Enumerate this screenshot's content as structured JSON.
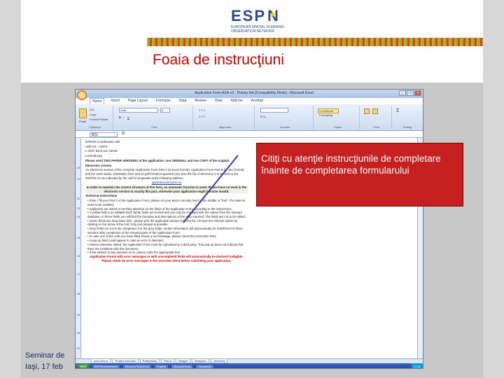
{
  "slide": {
    "title": "Foaia de instrucţiuni",
    "logo": {
      "letters_left": "ESP",
      "letters_right": "N",
      "subtitle": "EUROPEAN SPATIAL PLANNING OBSERVATION NETWORK"
    },
    "footer": {
      "line1": "Seminar de",
      "line2": "Iaşi, 17 feb"
    },
    "callout_text": "Citiţi cu atenţie instrucţiunile de completare înainte de completarea formularului",
    "colors": {
      "title": "#cc0000",
      "callout_bg": "#c62020",
      "callout_text": "#ffffff",
      "arrow": "#3a3aa0",
      "side_bars": "#d7d7d7"
    }
  },
  "excel": {
    "window_title": "Application Form-ASA-v2 - Priority link [Compatibility Mode] - Microsoft Excel",
    "tabs": [
      "Home",
      "Insert",
      "Page Layout",
      "Formulas",
      "Data",
      "Review",
      "View",
      "Add-Ins",
      "Acrobat"
    ],
    "active_tab": "Home",
    "ribbon_groups": [
      "Clipboard",
      "Font",
      "Alignment",
      "Number",
      "Styles",
      "Cells",
      "Editing"
    ],
    "clipboard_items": [
      "Cut",
      "Copy",
      "Format Painter"
    ],
    "paste_label": "Paste",
    "font_name": "Arial",
    "font_size": "8",
    "conditional_formatting": "Conditional Formatting",
    "name_box": "B21",
    "fx_label": "fx",
    "row_numbers": [
      "10",
      "11",
      "12",
      "13",
      "14",
      "15",
      "16",
      "17",
      "18",
      "19",
      "20",
      "21"
    ],
    "document": {
      "address": [
        "ESPON Coordination Unit",
        "CRP HT - CEPS",
        "L-4407 Esch-sur-Alzette",
        "Luxembourg"
      ],
      "paper_note": "Please send TWO PAPER VERSIONS of the application: one ORIGINAL and one COPY of the original.",
      "electronic_heading": "Electronic version",
      "electronic_text": "An electronic version of the complete Application Form Part A (in Excel format), Application Form Part B (in .doc format) and the work studio, Attestation form and (in pdf format) requested (see also the list of annexes) is to be sent to the ESPON CU as indicated by the call for proposals at the following address:",
      "email": "application@espon.eu",
      "warning_text": "In order to maintain the correct structure of this form, an automatic function is used. Please have no work in the electronic version in exactly this part, otherwise your application might become invalid.",
      "technical_heading": "Technical instructions",
      "bullets": [
        "Enter / fill your Part A of the Application Form, please set your Macro security level at the middle or \"low\". The Macros need to be enabled.",
        "Applicants are asked to set their attention on the fields of the Application Form according to the instructions.",
        "A yellow field is an editable field. White fields are locked and can only be changed with the values from the relevant database. In these fields you will find the formulas and descriptions of the data required. The fields are not to be edited.",
        "Green fields are drop down lists - please pick the applicable answer from the list. Choose the relevant option by clicking on the arrow of the cell. Only one answer is possible.",
        "Grey fields are not to be completed. For the grey fields, certain information will automatically be transferred to these sections after completion of the relevant parts of the Application Form.",
        "In case one of the cells you have filled shows a red message, please check the instruction field.",
        "A pop-up field could appear in case an error is detected.",
        "Unless otherwise stated, the Application Form must be submitted by a third party. This pop-up does not indicate that there are problems with the document.",
        "If the answer to any question is no, please mark the appropriate box."
      ],
      "red_note": "Application Forms with error messages or with uncompleted fields will automatically be declared ineligible. Please check for error messages in the overview sheet before submitting your application."
    },
    "sheet_tabs": [
      "Instructions",
      "Project overview",
      "Partnership",
      "Part A",
      "Budget",
      "Workplan",
      "Overview"
    ],
    "taskbar": {
      "start": "start",
      "items": [
        "ESPON presentation",
        "Microsoft PowerPoint",
        "Projects",
        "Microsoft Excel",
        "Document1"
      ],
      "clock": "17:41"
    }
  }
}
